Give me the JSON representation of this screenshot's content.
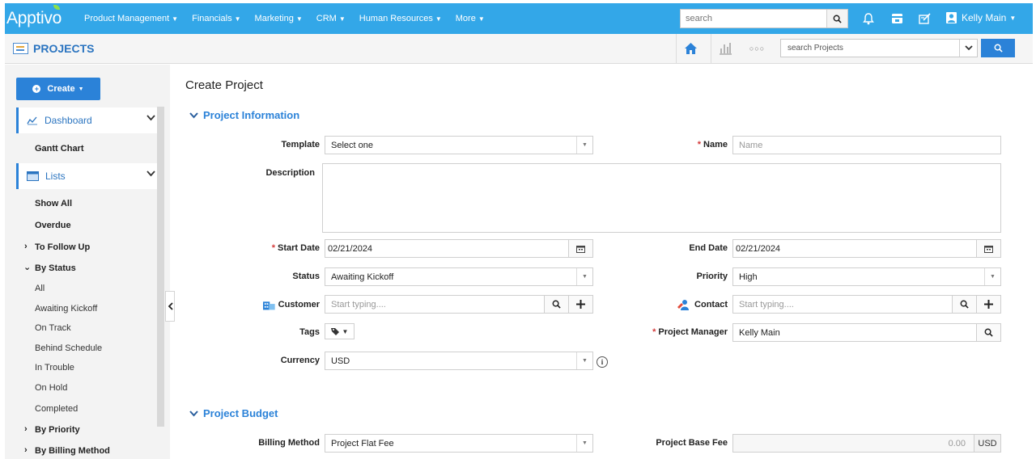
{
  "topnav": {
    "logo": "Apptivo",
    "items": [
      {
        "label": "Product Management"
      },
      {
        "label": "Financials"
      },
      {
        "label": "Marketing"
      },
      {
        "label": "CRM"
      },
      {
        "label": "Human Resources"
      },
      {
        "label": "More"
      }
    ],
    "search_placeholder": "search",
    "user_name": "Kelly Main"
  },
  "appbar": {
    "title": "PROJECTS",
    "search_label": "search Projects"
  },
  "sidebar": {
    "create_label": "Create",
    "dashboard_label": "Dashboard",
    "gantt_label": "Gantt Chart",
    "lists_label": "Lists",
    "show_all": "Show All",
    "overdue": "Overdue",
    "to_follow_up": "To Follow Up",
    "by_status": "By Status",
    "status_items": [
      "All",
      "Awaiting Kickoff",
      "On Track",
      "Behind Schedule",
      "In Trouble",
      "On Hold",
      "Completed"
    ],
    "by_priority": "By Priority",
    "by_billing": "By Billing Method"
  },
  "form": {
    "page_title": "Create Project",
    "section_info": "Project Information",
    "section_budget": "Project Budget",
    "template_label": "Template",
    "template_value": "Select one",
    "name_label": "Name",
    "name_placeholder": "Name",
    "description_label": "Description",
    "start_label": "Start Date",
    "start_value": "02/21/2024",
    "end_label": "End Date",
    "end_value": "02/21/2024",
    "status_label": "Status",
    "status_value": "Awaiting Kickoff",
    "priority_label": "Priority",
    "priority_value": "High",
    "customer_label": "Customer",
    "customer_placeholder": "Start typing....",
    "contact_label": "Contact",
    "contact_placeholder": "Start typing....",
    "tags_label": "Tags",
    "pm_label": "Project Manager",
    "pm_value": "Kelly Main",
    "currency_label": "Currency",
    "currency_value": "USD",
    "billing_label": "Billing Method",
    "billing_value": "Project Flat Fee",
    "base_fee_label": "Project Base Fee",
    "base_fee_value": "0.00",
    "base_fee_currency": "USD"
  },
  "colors": {
    "brand": "#33a7e8",
    "accent": "#2b82d8",
    "required": "#d43b3b"
  }
}
